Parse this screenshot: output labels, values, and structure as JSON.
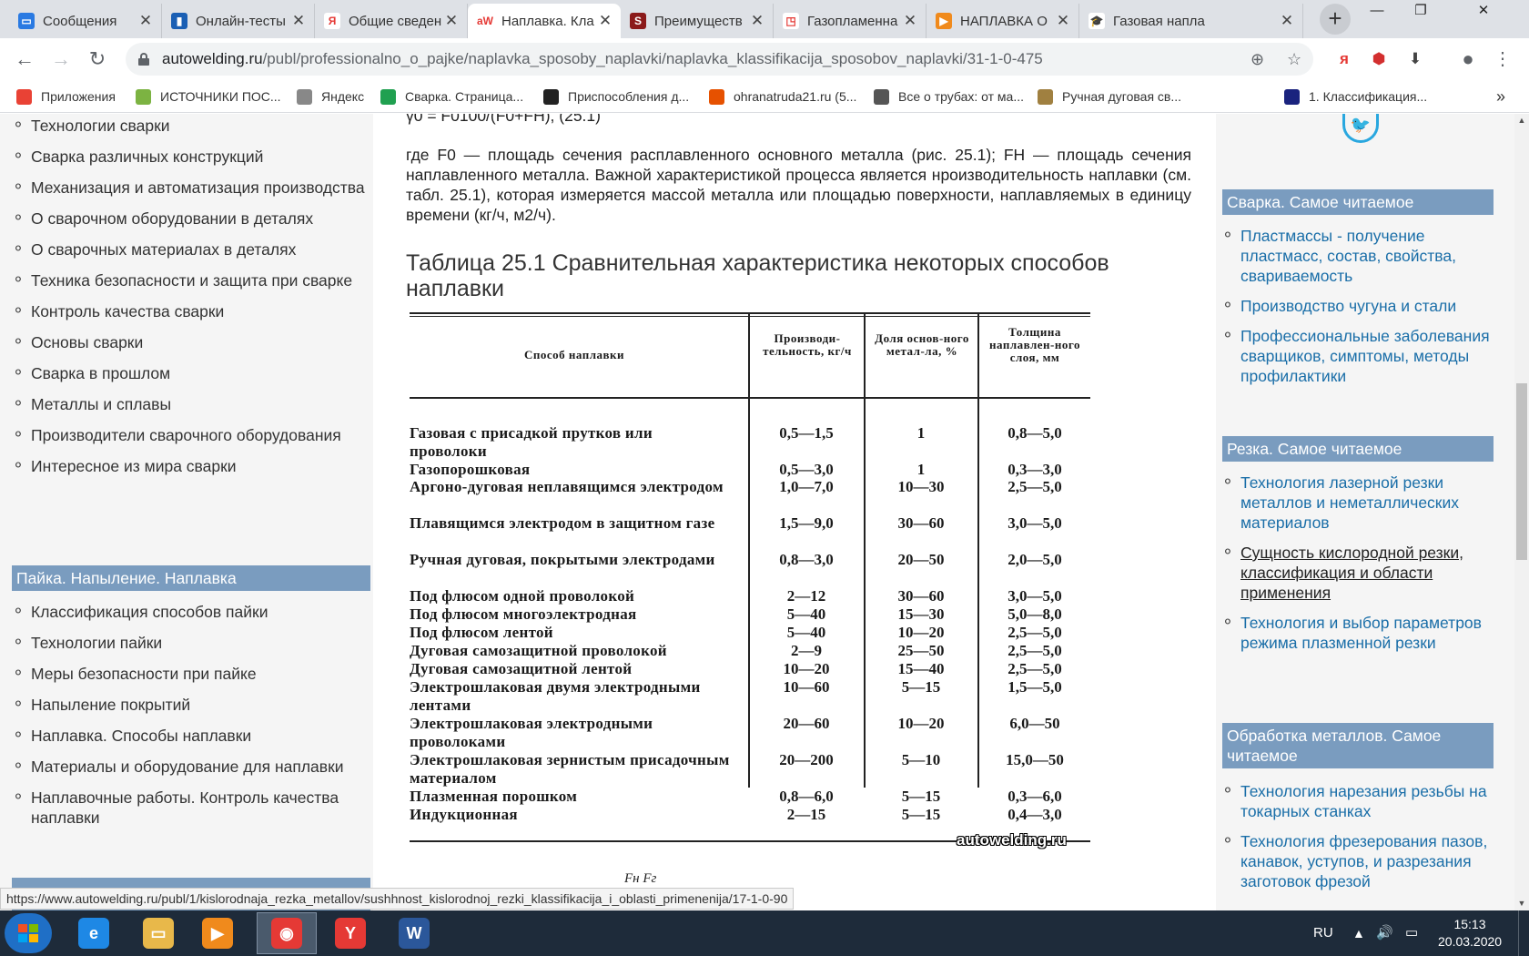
{
  "browser": {
    "tabs": [
      {
        "label": "Сообщения",
        "icon_color": "#2a7ae2",
        "icon_glyph": "▭"
      },
      {
        "label": "Онлайн-тесты",
        "icon_color": "#1a5fb4",
        "icon_glyph": "▮"
      },
      {
        "label": "Общие сведен",
        "icon_color": "#ffffff",
        "icon_glyph": "Я"
      },
      {
        "label": "Наплавка. Кла",
        "icon_color": "#ffffff",
        "icon_glyph": "aW"
      },
      {
        "label": "Преимуществ",
        "icon_color": "#8b1a1a",
        "icon_glyph": "S"
      },
      {
        "label": "Газопламенна",
        "icon_color": "#ffffff",
        "icon_glyph": "◳"
      },
      {
        "label": "НАПЛАВКА О",
        "icon_color": "#f08a1c",
        "icon_glyph": "▶"
      },
      {
        "label": "Газовая напла",
        "icon_color": "#ffffff",
        "icon_glyph": "🎓"
      }
    ],
    "new_tab": "+",
    "url_domain": "autowelding.ru",
    "url_path": "/publ/professionalno_o_pajke/naplavka_sposoby_naplavki/naplavka_klassifikacija_sposobov_naplavki/31-1-0-475",
    "bookmarks": [
      {
        "label": "Приложения",
        "color": "#e94235"
      },
      {
        "label": "ИСТОЧНИКИ ПОС...",
        "color": "#7cb342"
      },
      {
        "label": "Яндекс",
        "color": "#888888"
      },
      {
        "label": "Сварка. Страница...",
        "color": "#20a050"
      },
      {
        "label": "Приспособления д...",
        "color": "#222222"
      },
      {
        "label": "ohranatruda21.ru (5...",
        "color": "#e65100"
      },
      {
        "label": "Все о трубах: от ма...",
        "color": "#555555"
      },
      {
        "label": "Ручная дуговая св...",
        "color": "#a08040"
      },
      {
        "label": "1. Классификация...",
        "color": "#1a237e"
      }
    ],
    "bookmarks_more": "»",
    "status_url": "https://www.autowelding.ru/publ/1/kislorodnaja_rezka_metallov/sushhnost_kislorodnoj_rezki_klassifikacija_i_oblasti_primenenija/17-1-0-90"
  },
  "left_nav": {
    "items_top": [
      "Технологии сварки",
      "Сварка различных конструкций",
      "Механизация и автоматизация производства",
      "О сварочном оборудовании в деталях",
      "О сварочных материалах в деталях",
      "Техника безопасности и защита при сварке",
      "Контроль качества сварки",
      "Основы сварки",
      "Сварка в прошлом",
      "Металлы и сплавы",
      "Производители сварочного оборудования",
      "Интересное из мира сварки"
    ],
    "section_title": "Пайка. Напыление. Наплавка",
    "items_section": [
      "Классификация способов пайки",
      "Технологии пайки",
      "Меры безопасности при пайке",
      "Напыление покрытий",
      "Наплавка. Способы наплавки",
      "Материалы и оборудование для наплавки",
      "Наплавочные работы. Контроль качества наплавки"
    ]
  },
  "article": {
    "formula": "γ0 = F0100/(F0+FН), (25.1)",
    "paragraph": "где F0 — площадь сечения расплавленного основного металла (рис. 25.1); FН — площадь сечения наплавленного металла. Важной характеристикой процесса является нроизводительность наплавки (см. табл. 25.1), которая измеряется массой металла или площадью поверхности, наплавляемых в единицу времени (кг/ч, м2/ч).",
    "table_title": "Таблица 25.1 Сравнительная характеристика некоторых способов наплавки",
    "fragment": "Fн    Fг"
  },
  "scan_table": {
    "headers": [
      "Способ наплавки",
      "Производи-тельность, кг/ч",
      "Доля основ-ного метал-ла, %",
      "Толщина наплавлен-ного слоя, мм"
    ],
    "rows": [
      {
        "name": "Газовая с присадкой прутков или проволоки",
        "perf": "0,5—1,5",
        "share": "1",
        "thick": "0,8—5,0"
      },
      {
        "name": "Газопорошковая",
        "perf": "0,5—3,0",
        "share": "1",
        "thick": "0,3—3,0"
      },
      {
        "name": "Аргоно-дуговая неплавящимся электродом",
        "perf": "1,0—7,0",
        "share": "10—30",
        "thick": "2,5—5,0"
      },
      {
        "name": "Плавящимся электродом в защитном газе",
        "perf": "1,5—9,0",
        "share": "30—60",
        "thick": "3,0—5,0"
      },
      {
        "name": "Ручная дуговая, покрытыми электродами",
        "perf": "0,8—3,0",
        "share": "20—50",
        "thick": "2,0—5,0"
      },
      {
        "name": "Под флюсом одной проволокой",
        "perf": "2—12",
        "share": "30—60",
        "thick": "3,0—5,0"
      },
      {
        "name": "Под флюсом многоэлектродная",
        "perf": "5—40",
        "share": "15—30",
        "thick": "5,0—8,0"
      },
      {
        "name": "Под флюсом лентой",
        "perf": "5—40",
        "share": "10—20",
        "thick": "2,5—5,0"
      },
      {
        "name": "Дуговая самозащитной проволокой",
        "perf": "2—9",
        "share": "25—50",
        "thick": "2,5—5,0"
      },
      {
        "name": "Дуговая самозащитной лентой",
        "perf": "10—20",
        "share": "15—40",
        "thick": "2,5—5,0"
      },
      {
        "name": "Электрошлаковая двумя электродными лентами",
        "perf": "10—60",
        "share": "5—15",
        "thick": "1,5—5,0"
      },
      {
        "name": "Электрошлаковая электродными проволоками",
        "perf": "20—60",
        "share": "10—20",
        "thick": "6,0—50"
      },
      {
        "name": "Электрошлаковая зернистым присадочным материалом",
        "perf": "20—200",
        "share": "5—10",
        "thick": "15,0—50"
      },
      {
        "name": "Плазменная порошком",
        "perf": "0,8—6,0",
        "share": "5—15",
        "thick": "0,3—6,0"
      },
      {
        "name": "Индукционная",
        "perf": "2—15",
        "share": "5—15",
        "thick": "0,4—3,0"
      }
    ],
    "watermark": "autowelding.ru"
  },
  "right_nav": {
    "sections": [
      {
        "title": "Сварка. Самое читаемое",
        "items": [
          {
            "label": "Пластмассы - получение пластмасс, состав, свойства, свариваемость",
            "visited": false
          },
          {
            "label": "Производство чугуна и стали",
            "visited": false
          },
          {
            "label": "Профессиональные заболевания сварщиков, симптомы, методы профилактики",
            "visited": false
          }
        ]
      },
      {
        "title": "Резка. Самое читаемое",
        "items": [
          {
            "label": "Технология лазерной резки металлов и неметаллических материалов",
            "visited": false
          },
          {
            "label": "Сущность кислородной резки, классификация и области применения",
            "visited": true
          },
          {
            "label": "Технология и выбор параметров режима плазменной резки",
            "visited": false
          }
        ]
      },
      {
        "title": "Обработка металлов. Самое читаемое",
        "items": [
          {
            "label": "Технология нарезания резьбы на токарных станках",
            "visited": false
          },
          {
            "label": "Технология фрезерования пазов, канавок, уступов, и разрезания заготовок фрезой",
            "visited": false
          }
        ]
      }
    ]
  },
  "taskbar": {
    "apps": [
      {
        "name": "ie",
        "color": "#1e88e5",
        "glyph": "e"
      },
      {
        "name": "explorer",
        "color": "#e8b84a",
        "glyph": "▭"
      },
      {
        "name": "media-player",
        "color": "#f08a1c",
        "glyph": "▶"
      },
      {
        "name": "chrome",
        "color": "#e53935",
        "glyph": "◉"
      },
      {
        "name": "yandex",
        "color": "#e53935",
        "glyph": "Y"
      },
      {
        "name": "word",
        "color": "#2b579a",
        "glyph": "W"
      }
    ],
    "lang": "RU",
    "time": "15:13",
    "date": "20.03.2020"
  }
}
